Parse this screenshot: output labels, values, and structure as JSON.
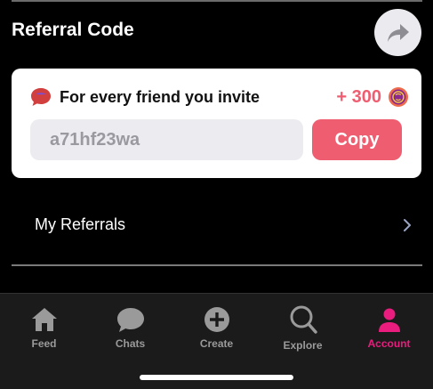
{
  "referral": {
    "section_title": "Referral Code",
    "share_icon": "share-arrow-icon",
    "card": {
      "headline": "For every friend you invite",
      "reward": "+ 300",
      "code": "a71hf23wa",
      "copy_label": "Copy"
    },
    "my_referrals_label": "My Referrals"
  },
  "tabs": [
    {
      "label": "Feed",
      "icon": "home-icon",
      "active": false
    },
    {
      "label": "Chats",
      "icon": "chat-icon",
      "active": false
    },
    {
      "label": "Create",
      "icon": "plus-circle-icon",
      "active": false
    },
    {
      "label": "Explore",
      "icon": "search-icon",
      "active": false
    },
    {
      "label": "Account",
      "icon": "person-icon",
      "active": true
    }
  ],
  "colors": {
    "accent": "#ef5d70",
    "active_tab": "#e81d7e",
    "background": "#000000",
    "card": "#ffffff",
    "tab_bar": "#1b1b1b"
  }
}
